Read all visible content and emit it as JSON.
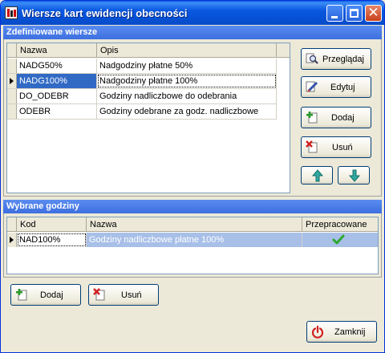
{
  "window": {
    "title": "Wiersze kart ewidencji obecności"
  },
  "defined": {
    "section_title": "Zdefiniowane wiersze",
    "columns": [
      "Nazwa",
      "Opis"
    ],
    "rows": [
      {
        "nazwa": "NADG50%",
        "opis": "Nadgodziny płatne 50%"
      },
      {
        "nazwa": "NADG100%",
        "opis": "Nadgodziny płatne 100%"
      },
      {
        "nazwa": "DO_ODEBR",
        "opis": "Godziny nadliczbowe do odebrania"
      },
      {
        "nazwa": "ODEBR",
        "opis": "Godziny odebrane za godz. nadliczbowe"
      }
    ],
    "buttons": {
      "przegladaj": "Przeglądaj",
      "edytuj": "Edytuj",
      "dodaj": "Dodaj",
      "usun": "Usuń"
    }
  },
  "selected": {
    "section_title": "Wybrane godziny",
    "columns": [
      "Kod",
      "Nazwa",
      "Przepracowane"
    ],
    "rows": [
      {
        "kod": "NAD100%",
        "nazwa": "Godziny nadliczbowe płatne 100%",
        "przepracowane": true
      }
    ],
    "buttons": {
      "dodaj": "Dodaj",
      "usun": "Usuń"
    }
  },
  "footer": {
    "zamknij": "Zamknij"
  },
  "icons": {
    "check": "checkmark-icon",
    "up": "arrow-up-icon",
    "down": "arrow-down-icon"
  },
  "colors": {
    "title_bar": "#0a58e0",
    "section_bar": "#3d6fe0",
    "selection": "#316ac5",
    "check": "#2fa82f",
    "close_red": "#d02020"
  }
}
